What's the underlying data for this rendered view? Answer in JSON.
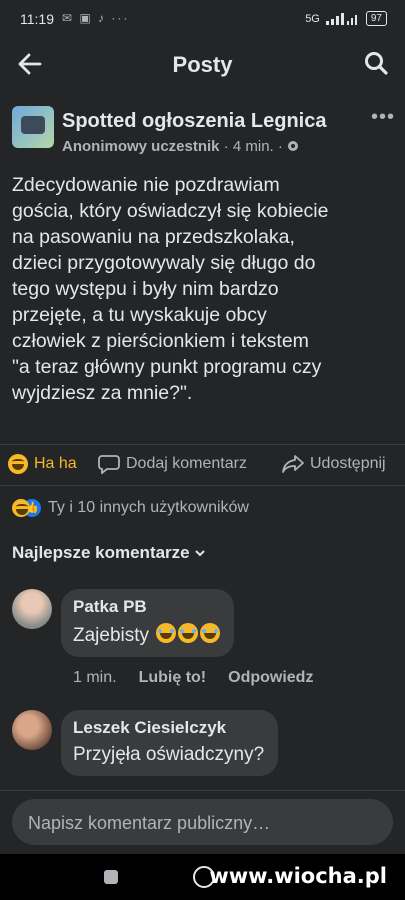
{
  "status_bar": {
    "time": "11:19",
    "left_icons": "✉ ▣ ♪ ···",
    "network": "5G",
    "battery": "97"
  },
  "app_bar": {
    "title": "Posty"
  },
  "post": {
    "page_name": "Spotted ogłoszenia Legnica",
    "author": "Anonimowy uczestnik",
    "time": "· 4 min. ·",
    "text": "Zdecydowanie nie pozdrawiam\ngościa, który oświadczył się kobiecie\nna pasowaniu na przedszkolaka,\ndzieci przygotowywaly się długo do\ntego występu i były nim bardzo\nprzejęte, a tu wyskakuje obcy\nczłowiek z  pierścionkiem i tekstem\n\"a teraz główny punkt programu czy\nwyjdziesz za mnie?\".",
    "actions": {
      "reaction_label": "Ha ha",
      "comment_label": "Dodaj komentarz",
      "share_label": "Udostępnij"
    },
    "reactions_summary": "Ty i 10 innych użytkowników"
  },
  "comments_section": {
    "sort_label": "Najlepsze komentarze",
    "comments": [
      {
        "name": "Patka PB",
        "text": "Zajebisty",
        "time": "1 min.",
        "like_label": "Lubię to!",
        "reply_label": "Odpowiedz"
      },
      {
        "name": "Leszek Ciesielczyk",
        "text": "Przyjęła oświadczyny?"
      }
    ]
  },
  "composer": {
    "placeholder": "Napisz komentarz publiczny…"
  },
  "watermark": "www.wiocha.pl",
  "colors": {
    "background": "#242526",
    "bubble": "#3a3b3c",
    "text_primary": "#e4e6eb",
    "text_secondary": "#b0b3b8",
    "haha": "#f7b928",
    "like": "#1877f2"
  }
}
